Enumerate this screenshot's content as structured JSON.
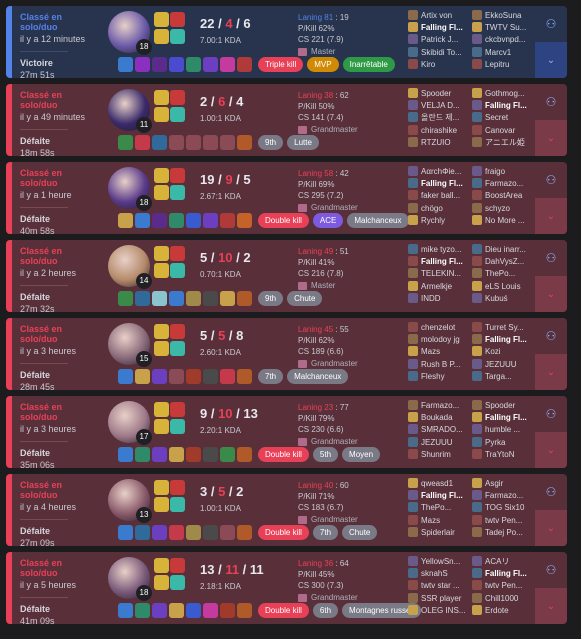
{
  "matches": [
    {
      "queue": "Classé en solo/duo",
      "ago": "il y a 12 minutes",
      "result": "Victoire",
      "duration": "27m 51s",
      "win": true,
      "level": "18",
      "kills": "22",
      "deaths": "4",
      "assists": "6",
      "ratio": "7.00:1 KDA",
      "lane": "Laning 81",
      "lane_rank": ": 19",
      "pkill": "P/Kill 62%",
      "cs": "CS 221 (7.9)",
      "rank": "Master",
      "badges": [
        {
          "label": "Triple kill",
          "style": "red"
        },
        {
          "label": "MVP",
          "style": "gold"
        },
        {
          "label": "Inarrêtable",
          "style": "green"
        }
      ],
      "items": [
        "#3b7bcf",
        "#8a2fbf",
        "#5a2b8a",
        "#4b4bcf",
        "#2f8a6a",
        "#6b3fbf",
        "#c43a9f",
        "#b03a3a"
      ],
      "team1": [
        {
          "name": "Artix von"
        },
        {
          "name": "Falling Fl...",
          "me": true
        },
        {
          "name": "Patrick J..."
        },
        {
          "name": "Skibidi To..."
        },
        {
          "name": "Kiro"
        }
      ],
      "team2": [
        {
          "name": "EkkoSuna"
        },
        {
          "name": "TWTV Su..."
        },
        {
          "name": "ckcbvnpd..."
        },
        {
          "name": "Marcv1"
        },
        {
          "name": "Lepitru"
        }
      ]
    },
    {
      "queue": "Classé en solo/duo",
      "ago": "il y a 49 minutes",
      "result": "Défaite",
      "duration": "18m 58s",
      "win": false,
      "level": "11",
      "kills": "2",
      "deaths": "6",
      "assists": "4",
      "ratio": "1.00:1 KDA",
      "lane": "Laning 38",
      "lane_rank": ": 62",
      "pkill": "P/Kill 50%",
      "cs": "CS 141 (7.4)",
      "rank": "Grandmaster",
      "badges": [
        {
          "label": "9th",
          "style": "grey"
        },
        {
          "label": "Lutte",
          "style": "grey"
        }
      ],
      "items": [
        "#3a8a4a",
        "#c43a4a",
        "#2f6a9a",
        "",
        "",
        "",
        "",
        "#b05a2a"
      ],
      "team1": [
        {
          "name": "Spooder"
        },
        {
          "name": "VELJA D..."
        },
        {
          "name": "올란드 제..."
        },
        {
          "name": "chirashike"
        },
        {
          "name": "RTZUIO"
        }
      ],
      "team2": [
        {
          "name": "Gothmog..."
        },
        {
          "name": "Falling Fl...",
          "me": true
        },
        {
          "name": "Secret"
        },
        {
          "name": "Canovar"
        },
        {
          "name": "アニエル姫"
        }
      ]
    },
    {
      "queue": "Classé en solo/duo",
      "ago": "il y a 1 heure",
      "result": "Défaite",
      "duration": "40m 58s",
      "win": false,
      "level": "18",
      "kills": "19",
      "deaths": "9",
      "assists": "5",
      "ratio": "2.67:1 KDA",
      "lane": "Laning 58",
      "lane_rank": ": 42",
      "pkill": "P/Kill 69%",
      "cs": "CS 295 (7.2)",
      "rank": "Grandmaster",
      "badges": [
        {
          "label": "Double kill",
          "style": "red"
        },
        {
          "label": "ACE",
          "style": "purple"
        },
        {
          "label": "Malchanceux",
          "style": "grey"
        }
      ],
      "items": [
        "#c8a24a",
        "#3b7bcf",
        "#5a2b8a",
        "#2f8a6a",
        "#3a5acf",
        "#6b3fbf",
        "#b03a3a",
        "#c4622a"
      ],
      "team1": [
        {
          "name": "AαrchΦie..."
        },
        {
          "name": "Falling Fl...",
          "me": true
        },
        {
          "name": "faker ball..."
        },
        {
          "name": "chögo"
        },
        {
          "name": "Rychly"
        }
      ],
      "team2": [
        {
          "name": "fraigo"
        },
        {
          "name": "Farmazo..."
        },
        {
          "name": "BoostArea"
        },
        {
          "name": "schyzo"
        },
        {
          "name": "No More ..."
        }
      ]
    },
    {
      "queue": "Classé en solo/duo",
      "ago": "il y a 2 heures",
      "result": "Défaite",
      "duration": "27m 32s",
      "win": false,
      "level": "14",
      "kills": "5",
      "deaths": "10",
      "assists": "2",
      "ratio": "0.70:1 KDA",
      "lane": "Laning 49",
      "lane_rank": ": 51",
      "pkill": "P/Kill 41%",
      "cs": "CS 216 (7.8)",
      "rank": "Master",
      "badges": [
        {
          "label": "9th",
          "style": "grey"
        },
        {
          "label": "Chute",
          "style": "grey"
        }
      ],
      "items": [
        "#3a8a4a",
        "#2f6a9a",
        "#8ac4cf",
        "#3b7bcf",
        "#a08a4a",
        "#4a4a4a",
        "#c8a24a",
        "#b05a2a"
      ],
      "team1": [
        {
          "name": "mike tyzo..."
        },
        {
          "name": "Falling Fl...",
          "me": true
        },
        {
          "name": "TELEKIN..."
        },
        {
          "name": "Armelkje"
        },
        {
          "name": "INDD"
        }
      ],
      "team2": [
        {
          "name": "Dieu inarr..."
        },
        {
          "name": "DahVysZ..."
        },
        {
          "name": "ThePo..."
        },
        {
          "name": "eLS Louis"
        },
        {
          "name": "Kubuś"
        }
      ]
    },
    {
      "queue": "Classé en solo/duo",
      "ago": "il y a 3 heures",
      "result": "Défaite",
      "duration": "28m 45s",
      "win": false,
      "level": "15",
      "kills": "5",
      "deaths": "5",
      "assists": "8",
      "ratio": "2.60:1 KDA",
      "lane": "Laning 45",
      "lane_rank": ": 55",
      "pkill": "P/Kill 62%",
      "cs": "CS 189 (6.6)",
      "rank": "Grandmaster",
      "badges": [
        {
          "label": "7th",
          "style": "grey"
        },
        {
          "label": "Malchanceux",
          "style": "grey"
        }
      ],
      "items": [
        "#3b7bcf",
        "#c8a24a",
        "#6b3fbf",
        "",
        "#a03a2a",
        "#4a4a4a",
        "#c43a4a",
        "#b05a2a"
      ],
      "team1": [
        {
          "name": "chenzelot"
        },
        {
          "name": "molodoy jg"
        },
        {
          "name": "Mazs"
        },
        {
          "name": "Rush B P..."
        },
        {
          "name": "Fleshy"
        }
      ],
      "team2": [
        {
          "name": "Turret Sy..."
        },
        {
          "name": "Falling Fl...",
          "me": true
        },
        {
          "name": "Kozi"
        },
        {
          "name": "JEZUUU"
        },
        {
          "name": "Targa..."
        }
      ]
    },
    {
      "queue": "Classé en solo/duo",
      "ago": "il y a 3 heures",
      "result": "Défaite",
      "duration": "35m 06s",
      "win": false,
      "level": "17",
      "kills": "9",
      "deaths": "10",
      "assists": "13",
      "ratio": "2.20:1 KDA",
      "lane": "Laning 23",
      "lane_rank": ": 77",
      "pkill": "P/Kill 79%",
      "cs": "CS 230 (6.6)",
      "rank": "Grandmaster",
      "badges": [
        {
          "label": "Double kill",
          "style": "red"
        },
        {
          "label": "5th",
          "style": "grey"
        },
        {
          "label": "Moyen",
          "style": "grey"
        }
      ],
      "items": [
        "#3b7bcf",
        "#2f8a6a",
        "#6b3fbf",
        "#c8a24a",
        "#a03a2a",
        "#4a4a4a",
        "#3a8a4a",
        "#b05a2a"
      ],
      "team1": [
        {
          "name": "Farmazo..."
        },
        {
          "name": "Boukada"
        },
        {
          "name": "SMRADO..."
        },
        {
          "name": "JEZUUU"
        },
        {
          "name": "Shunrim"
        }
      ],
      "team2": [
        {
          "name": "Spooder"
        },
        {
          "name": "Falling Fl...",
          "me": true
        },
        {
          "name": "humble ..."
        },
        {
          "name": "Pyrka"
        },
        {
          "name": "TraYtoN"
        }
      ]
    },
    {
      "queue": "Classé en solo/duo",
      "ago": "il y a 4 heures",
      "result": "Défaite",
      "duration": "27m 09s",
      "win": false,
      "level": "13",
      "kills": "3",
      "deaths": "5",
      "assists": "2",
      "ratio": "1.00:1 KDA",
      "lane": "Laning 40",
      "lane_rank": ": 60",
      "pkill": "P/Kill 71%",
      "cs": "CS 183 (6.7)",
      "rank": "Grandmaster",
      "badges": [
        {
          "label": "Double kill",
          "style": "red"
        },
        {
          "label": "7th",
          "style": "grey"
        },
        {
          "label": "Chute",
          "style": "grey"
        }
      ],
      "items": [
        "#3b7bcf",
        "#2f6a9a",
        "#6b3fbf",
        "#c43a4a",
        "#a08a4a",
        "#4a4a4a",
        "",
        "#b05a2a"
      ],
      "team1": [
        {
          "name": "qweasd1"
        },
        {
          "name": "Falling Fl...",
          "me": true
        },
        {
          "name": "ThePo..."
        },
        {
          "name": "Mazs"
        },
        {
          "name": "Spiderlair"
        }
      ],
      "team2": [
        {
          "name": "Asgir"
        },
        {
          "name": "Farmazo..."
        },
        {
          "name": "TOG Six10"
        },
        {
          "name": "twtv Pen..."
        },
        {
          "name": "Tadej Po..."
        }
      ]
    },
    {
      "queue": "Classé en solo/duo",
      "ago": "il y a 5 heures",
      "result": "Défaite",
      "duration": "41m 09s",
      "win": false,
      "level": "18",
      "kills": "13",
      "deaths": "11",
      "assists": "11",
      "ratio": "2.18:1 KDA",
      "lane": "Laning 36",
      "lane_rank": ": 64",
      "pkill": "P/Kill 45%",
      "cs": "CS 300 (7.3)",
      "rank": "Grandmaster",
      "badges": [
        {
          "label": "Double kill",
          "style": "red"
        },
        {
          "label": "6th",
          "style": "grey"
        },
        {
          "label": "Montagnes russes",
          "style": "grey"
        }
      ],
      "items": [
        "#3b7bcf",
        "#2f8a6a",
        "#6b3fbf",
        "#c8a24a",
        "#3a5acf",
        "#c43a9f",
        "#a03a2a",
        "#b05a2a"
      ],
      "team1": [
        {
          "name": "YellowSn..."
        },
        {
          "name": "sknahS"
        },
        {
          "name": "twtv star ..."
        },
        {
          "name": "SSR player"
        },
        {
          "name": "OLEG INS..."
        }
      ],
      "team2": [
        {
          "name": "ACAリ"
        },
        {
          "name": "Falling Fl...",
          "me": true
        },
        {
          "name": "twtv Pen..."
        },
        {
          "name": "Chill1000"
        },
        {
          "name": "Erdote"
        }
      ]
    }
  ],
  "icons": {
    "add_friend": "add-friend-icon",
    "expand": "chevron-down-icon"
  },
  "colors": {
    "win_accent": "#5383e8",
    "loss_accent": "#e84057",
    "win_bg": "#28344e",
    "loss_bg": "#59303a"
  }
}
